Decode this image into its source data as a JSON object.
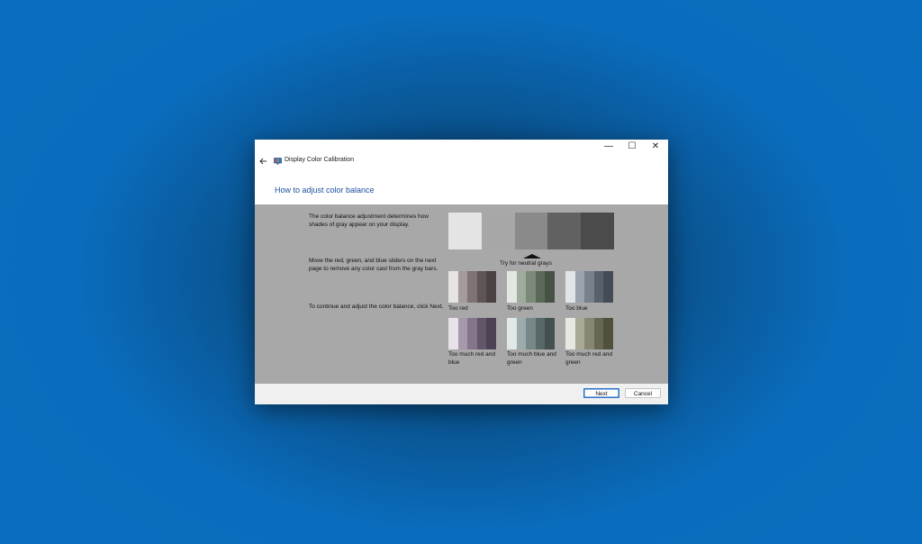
{
  "window": {
    "title": "Display Color Calibration",
    "controls": {
      "minimize": "—",
      "maximize": "☐",
      "close": "✕"
    }
  },
  "page": {
    "heading": "How to adjust color balance"
  },
  "instructions": [
    "The color balance adjustment determines how shades of gray appear on your display.",
    "Move the red, green, and blue sliders on the next page to remove any color cast from the gray bars.",
    "To continue and adjust the color balance, click Next."
  ],
  "neutral_strip": {
    "label": "Try for neutral grays",
    "colors": [
      "#e4e4e4",
      "#a7a7a7",
      "#8a8a8a",
      "#616161",
      "#4b4b4b"
    ]
  },
  "swatches": [
    {
      "label": "Too red",
      "colors": [
        "#e6e3e3",
        "#a49b9b",
        "#7f7373",
        "#605555",
        "#4b4242"
      ]
    },
    {
      "label": "Too green",
      "colors": [
        "#e3e7e2",
        "#9fac9d",
        "#7b8a78",
        "#5b6a58",
        "#465244"
      ]
    },
    {
      "label": "Too blue",
      "colors": [
        "#e2e5e8",
        "#9ba4ad",
        "#77818c",
        "#58616b",
        "#434b54"
      ]
    },
    {
      "label": "Too much red and blue",
      "colors": [
        "#e7e3e8",
        "#a799ab",
        "#84768a",
        "#63566a",
        "#4d4253"
      ]
    },
    {
      "label": "Too much blue and green",
      "colors": [
        "#e2e8e8",
        "#9cabab",
        "#778888",
        "#586767",
        "#435050"
      ]
    },
    {
      "label": "Too much red and green",
      "colors": [
        "#e8e8e2",
        "#aaa997",
        "#878672",
        "#676652",
        "#51503f"
      ]
    }
  ],
  "buttons": {
    "next": "Next",
    "cancel": "Cancel"
  },
  "colors": {
    "accent": "#1a4f9c",
    "content_bg": "#a8a8a8",
    "desktop_bg": "#0a6cbd"
  }
}
